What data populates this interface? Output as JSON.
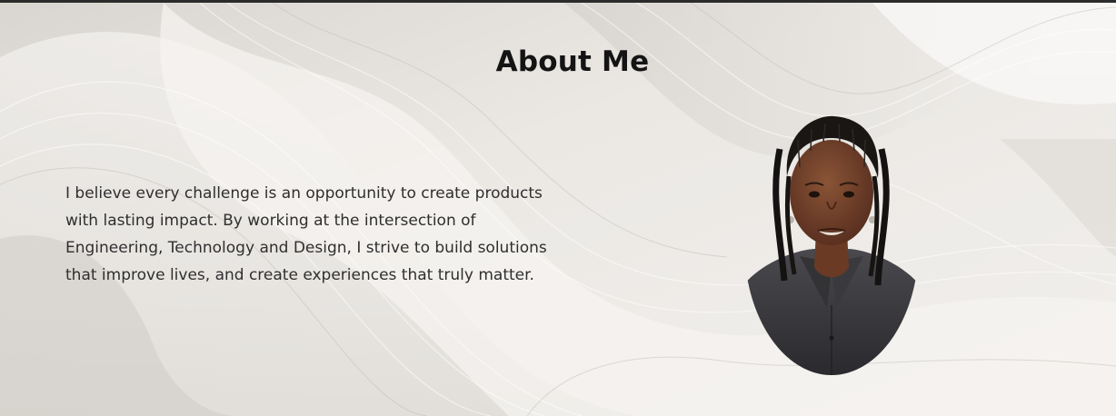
{
  "about": {
    "heading": "About Me",
    "bio": "I believe every challenge is an opportunity to create products with lasting impact. By working at the intersection of Engineering, Technology and Design, I strive to build solutions that improve lives, and create experiences that truly matter."
  },
  "portrait": {
    "subject": "profile-photo"
  }
}
